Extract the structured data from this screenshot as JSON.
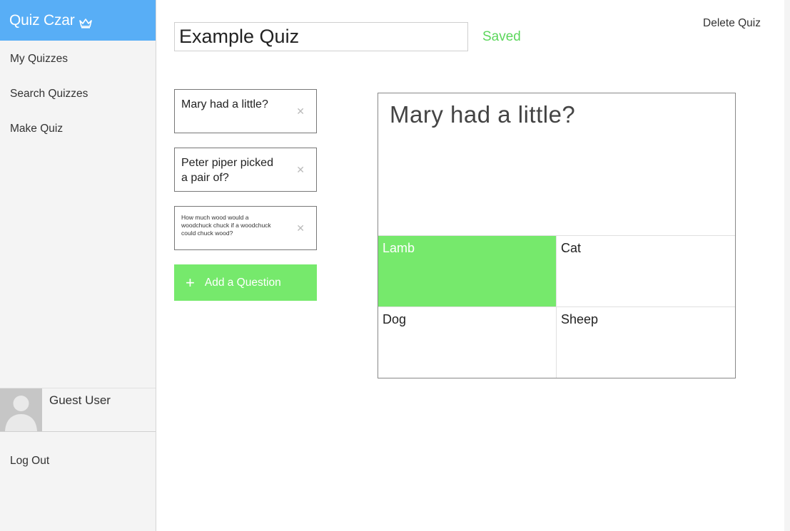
{
  "brand": {
    "name": "Quiz Czar",
    "accent": "#58aef6"
  },
  "nav": [
    {
      "label": "My Quizzes"
    },
    {
      "label": "Search Quizzes"
    },
    {
      "label": "Make Quiz"
    }
  ],
  "user": {
    "name": "Guest User"
  },
  "logout_label": "Log Out",
  "quiz": {
    "title": "Example Quiz",
    "status": "Saved",
    "delete_label": "Delete Quiz"
  },
  "questions": [
    {
      "text": "Mary had a little?"
    },
    {
      "text": "Peter piper picked a pair of?"
    },
    {
      "text": "How much wood would a woodchuck chuck if a woodchuck could chuck wood?"
    }
  ],
  "add_question_label": "Add a Question",
  "editor": {
    "prompt": "Mary had a little?",
    "answers": [
      {
        "label": "Lamb",
        "correct": true
      },
      {
        "label": "Cat",
        "correct": false
      },
      {
        "label": "Dog",
        "correct": false
      },
      {
        "label": "Sheep",
        "correct": false
      }
    ],
    "correct_color": "#76e96c"
  },
  "icons": {
    "crown": "crown-icon",
    "close": "close-icon",
    "plus": "plus-icon",
    "avatar": "avatar-icon"
  }
}
